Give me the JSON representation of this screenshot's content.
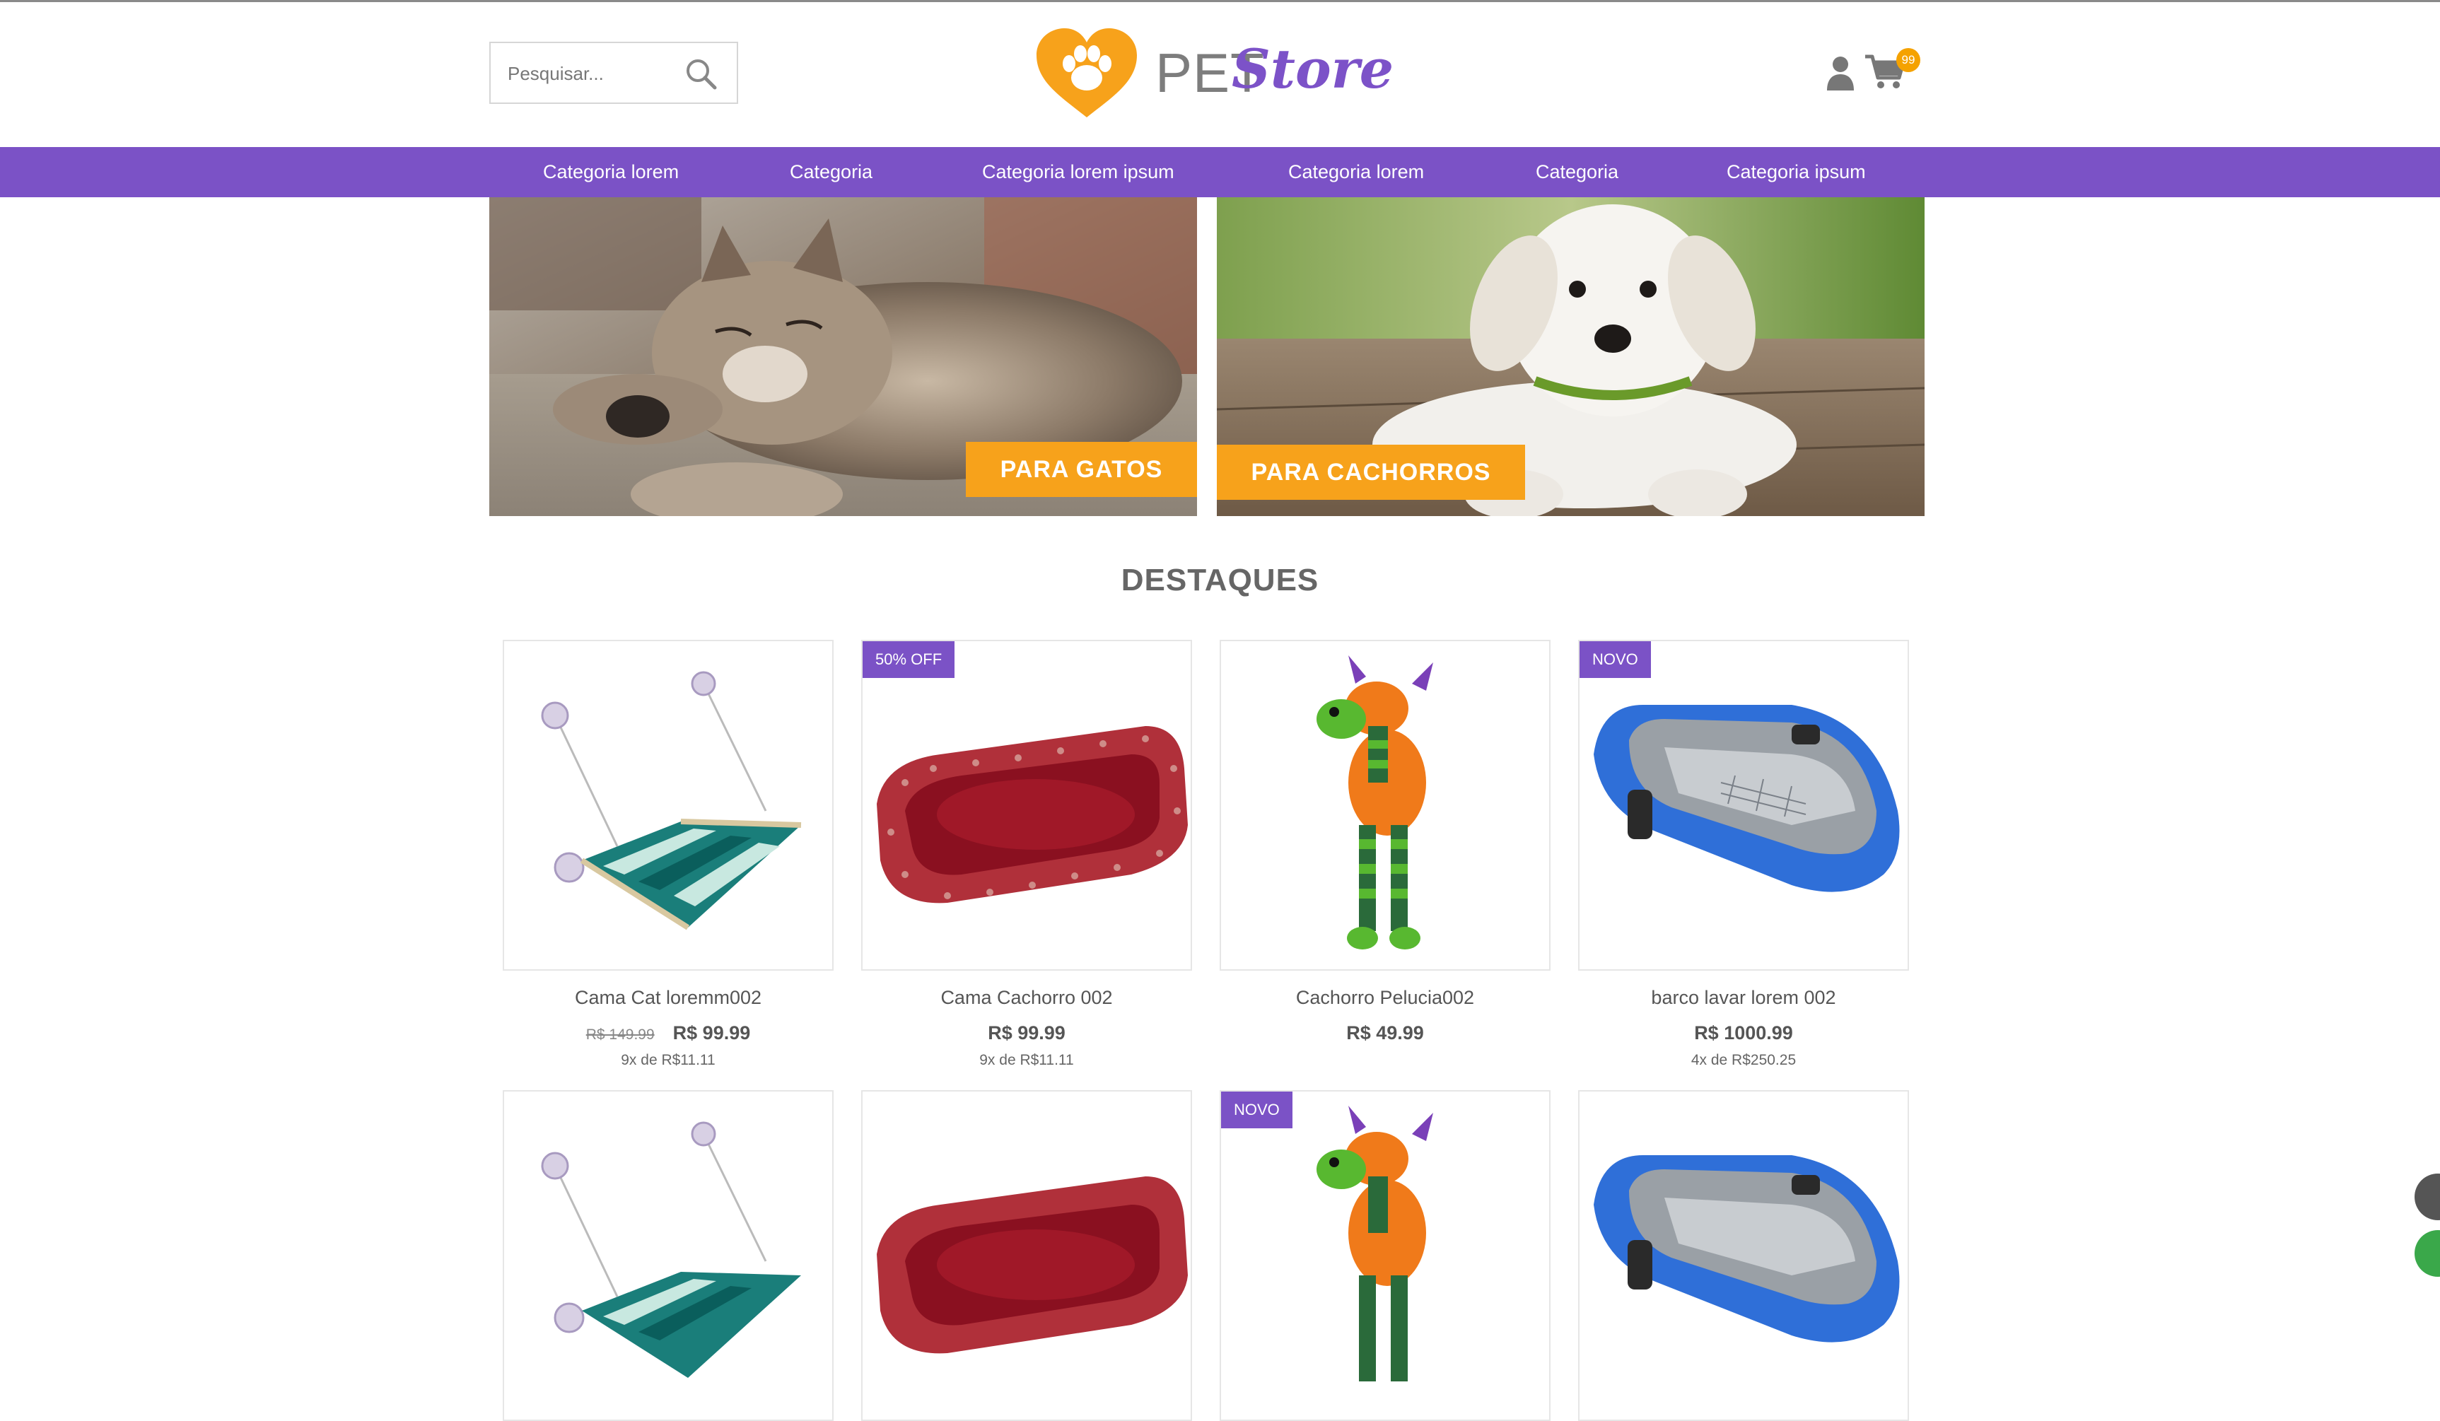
{
  "header": {
    "search_placeholder": "Pesquisar...",
    "logo_text_pet": "PET",
    "logo_text_store": "Store",
    "cart_count": "99"
  },
  "nav": {
    "items": [
      {
        "label": "Categoria lorem"
      },
      {
        "label": "Categoria"
      },
      {
        "label": "Categoria lorem ipsum"
      },
      {
        "label": "Categoria lorem"
      },
      {
        "label": "Categoria"
      },
      {
        "label": "Categoria ipsum"
      }
    ]
  },
  "banners": [
    {
      "button": "PARA GATOS"
    },
    {
      "button": "PARA CACHORROS"
    }
  ],
  "section": {
    "title": "DESTAQUES"
  },
  "products": [
    {
      "tag": "",
      "name": "Cama Cat loremm002",
      "old_price": "R$ 149.99",
      "price": "R$ 99.99",
      "installments": "9x de R$11.11"
    },
    {
      "tag": "50% OFF",
      "name": "Cama Cachorro 002",
      "old_price": "",
      "price": "R$ 99.99",
      "installments": "9x de R$11.11"
    },
    {
      "tag": "",
      "name": "Cachorro Pelucia002",
      "old_price": "",
      "price": "R$ 49.99",
      "installments": ""
    },
    {
      "tag": "NOVO",
      "name": "barco lavar lorem 002",
      "old_price": "",
      "price": "R$ 1000.99",
      "installments": "4x de R$250.25"
    },
    {
      "tag": ""
    },
    {
      "tag": ""
    },
    {
      "tag": "NOVO"
    },
    {
      "tag": ""
    }
  ],
  "colors": {
    "brand_purple": "#7b52c6",
    "accent_orange": "#f7a21b",
    "badge_orange": "#f5a200"
  },
  "icons": [
    "search-icon",
    "user-icon",
    "cart-icon",
    "paw-heart-logo-icon"
  ]
}
